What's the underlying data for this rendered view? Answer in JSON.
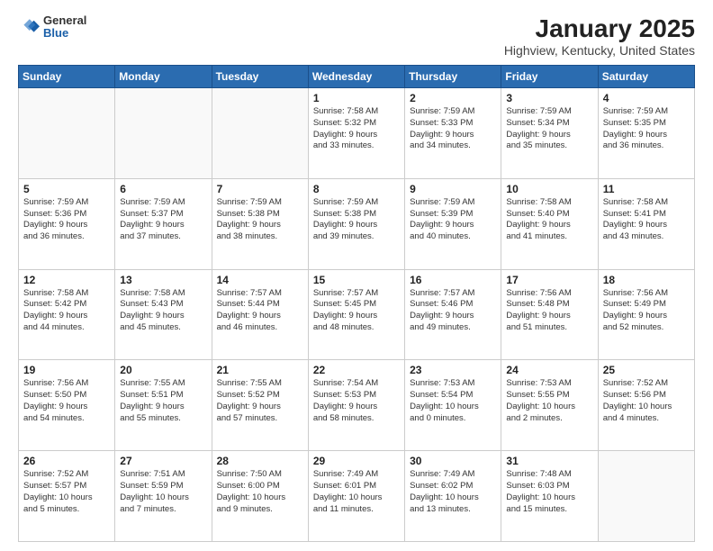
{
  "header": {
    "logo_general": "General",
    "logo_blue": "Blue",
    "month_title": "January 2025",
    "location": "Highview, Kentucky, United States"
  },
  "days_of_week": [
    "Sunday",
    "Monday",
    "Tuesday",
    "Wednesday",
    "Thursday",
    "Friday",
    "Saturday"
  ],
  "weeks": [
    [
      {
        "day": "",
        "text": ""
      },
      {
        "day": "",
        "text": ""
      },
      {
        "day": "",
        "text": ""
      },
      {
        "day": "1",
        "text": "Sunrise: 7:58 AM\nSunset: 5:32 PM\nDaylight: 9 hours\nand 33 minutes."
      },
      {
        "day": "2",
        "text": "Sunrise: 7:59 AM\nSunset: 5:33 PM\nDaylight: 9 hours\nand 34 minutes."
      },
      {
        "day": "3",
        "text": "Sunrise: 7:59 AM\nSunset: 5:34 PM\nDaylight: 9 hours\nand 35 minutes."
      },
      {
        "day": "4",
        "text": "Sunrise: 7:59 AM\nSunset: 5:35 PM\nDaylight: 9 hours\nand 36 minutes."
      }
    ],
    [
      {
        "day": "5",
        "text": "Sunrise: 7:59 AM\nSunset: 5:36 PM\nDaylight: 9 hours\nand 36 minutes."
      },
      {
        "day": "6",
        "text": "Sunrise: 7:59 AM\nSunset: 5:37 PM\nDaylight: 9 hours\nand 37 minutes."
      },
      {
        "day": "7",
        "text": "Sunrise: 7:59 AM\nSunset: 5:38 PM\nDaylight: 9 hours\nand 38 minutes."
      },
      {
        "day": "8",
        "text": "Sunrise: 7:59 AM\nSunset: 5:38 PM\nDaylight: 9 hours\nand 39 minutes."
      },
      {
        "day": "9",
        "text": "Sunrise: 7:59 AM\nSunset: 5:39 PM\nDaylight: 9 hours\nand 40 minutes."
      },
      {
        "day": "10",
        "text": "Sunrise: 7:58 AM\nSunset: 5:40 PM\nDaylight: 9 hours\nand 41 minutes."
      },
      {
        "day": "11",
        "text": "Sunrise: 7:58 AM\nSunset: 5:41 PM\nDaylight: 9 hours\nand 43 minutes."
      }
    ],
    [
      {
        "day": "12",
        "text": "Sunrise: 7:58 AM\nSunset: 5:42 PM\nDaylight: 9 hours\nand 44 minutes."
      },
      {
        "day": "13",
        "text": "Sunrise: 7:58 AM\nSunset: 5:43 PM\nDaylight: 9 hours\nand 45 minutes."
      },
      {
        "day": "14",
        "text": "Sunrise: 7:57 AM\nSunset: 5:44 PM\nDaylight: 9 hours\nand 46 minutes."
      },
      {
        "day": "15",
        "text": "Sunrise: 7:57 AM\nSunset: 5:45 PM\nDaylight: 9 hours\nand 48 minutes."
      },
      {
        "day": "16",
        "text": "Sunrise: 7:57 AM\nSunset: 5:46 PM\nDaylight: 9 hours\nand 49 minutes."
      },
      {
        "day": "17",
        "text": "Sunrise: 7:56 AM\nSunset: 5:48 PM\nDaylight: 9 hours\nand 51 minutes."
      },
      {
        "day": "18",
        "text": "Sunrise: 7:56 AM\nSunset: 5:49 PM\nDaylight: 9 hours\nand 52 minutes."
      }
    ],
    [
      {
        "day": "19",
        "text": "Sunrise: 7:56 AM\nSunset: 5:50 PM\nDaylight: 9 hours\nand 54 minutes."
      },
      {
        "day": "20",
        "text": "Sunrise: 7:55 AM\nSunset: 5:51 PM\nDaylight: 9 hours\nand 55 minutes."
      },
      {
        "day": "21",
        "text": "Sunrise: 7:55 AM\nSunset: 5:52 PM\nDaylight: 9 hours\nand 57 minutes."
      },
      {
        "day": "22",
        "text": "Sunrise: 7:54 AM\nSunset: 5:53 PM\nDaylight: 9 hours\nand 58 minutes."
      },
      {
        "day": "23",
        "text": "Sunrise: 7:53 AM\nSunset: 5:54 PM\nDaylight: 10 hours\nand 0 minutes."
      },
      {
        "day": "24",
        "text": "Sunrise: 7:53 AM\nSunset: 5:55 PM\nDaylight: 10 hours\nand 2 minutes."
      },
      {
        "day": "25",
        "text": "Sunrise: 7:52 AM\nSunset: 5:56 PM\nDaylight: 10 hours\nand 4 minutes."
      }
    ],
    [
      {
        "day": "26",
        "text": "Sunrise: 7:52 AM\nSunset: 5:57 PM\nDaylight: 10 hours\nand 5 minutes."
      },
      {
        "day": "27",
        "text": "Sunrise: 7:51 AM\nSunset: 5:59 PM\nDaylight: 10 hours\nand 7 minutes."
      },
      {
        "day": "28",
        "text": "Sunrise: 7:50 AM\nSunset: 6:00 PM\nDaylight: 10 hours\nand 9 minutes."
      },
      {
        "day": "29",
        "text": "Sunrise: 7:49 AM\nSunset: 6:01 PM\nDaylight: 10 hours\nand 11 minutes."
      },
      {
        "day": "30",
        "text": "Sunrise: 7:49 AM\nSunset: 6:02 PM\nDaylight: 10 hours\nand 13 minutes."
      },
      {
        "day": "31",
        "text": "Sunrise: 7:48 AM\nSunset: 6:03 PM\nDaylight: 10 hours\nand 15 minutes."
      },
      {
        "day": "",
        "text": ""
      }
    ]
  ]
}
